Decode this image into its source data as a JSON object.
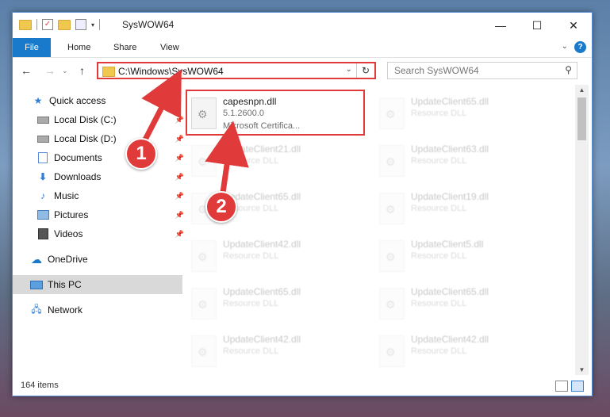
{
  "window": {
    "title": "SysWOW64",
    "controls": [
      "—",
      "☐",
      "✕"
    ]
  },
  "ribbon": {
    "tabs": [
      "File",
      "Home",
      "Share",
      "View"
    ],
    "help": "?"
  },
  "address": {
    "path": "C:\\Windows\\SysWOW64",
    "search_placeholder": "Search SysWOW64"
  },
  "sidebar": {
    "items": [
      {
        "label": "Quick access",
        "icon": "star-icon"
      },
      {
        "label": "Local Disk (C:)",
        "icon": "drive-icon"
      },
      {
        "label": "Local Disk (D:)",
        "icon": "drive-icon"
      },
      {
        "label": "Documents",
        "icon": "documents-icon"
      },
      {
        "label": "Downloads",
        "icon": "download-icon"
      },
      {
        "label": "Music",
        "icon": "music-icon"
      },
      {
        "label": "Pictures",
        "icon": "pictures-icon"
      },
      {
        "label": "Videos",
        "icon": "videos-icon"
      },
      {
        "label": "OneDrive",
        "icon": "cloud-icon"
      },
      {
        "label": "This PC",
        "icon": "computer-icon"
      },
      {
        "label": "Network",
        "icon": "network-icon"
      }
    ]
  },
  "files": [
    {
      "name": "capesnpn.dll",
      "line1": "5.1.2600.0",
      "line2": "Microsoft Certifica..."
    },
    {
      "name": "UpdateClient65.dll",
      "line1": "Resource DLL"
    },
    {
      "name": "UpdateClient21.dll",
      "line1": "Resource DLL"
    },
    {
      "name": "UpdateClient63.dll",
      "line1": "Resource DLL"
    },
    {
      "name": "UpdateClient65.dll",
      "line1": "Resource DLL"
    },
    {
      "name": "UpdateClient19.dll",
      "line1": "Resource DLL"
    },
    {
      "name": "UpdateClient42.dll",
      "line1": "Resource DLL"
    },
    {
      "name": "UpdateClient5.dll",
      "line1": "Resource DLL"
    },
    {
      "name": "UpdateClient65.dll",
      "line1": "Resource DLL"
    },
    {
      "name": "UpdateClient65.dll",
      "line1": "Resource DLL"
    },
    {
      "name": "UpdateClient42.dll",
      "line1": "Resource DLL"
    },
    {
      "name": "UpdateClient42.dll",
      "line1": "Resource DLL"
    }
  ],
  "status": {
    "count": "164 items"
  },
  "annotations": [
    "1",
    "2"
  ],
  "colors": {
    "accent": "#1979ca",
    "highlight": "#e03a3a"
  }
}
